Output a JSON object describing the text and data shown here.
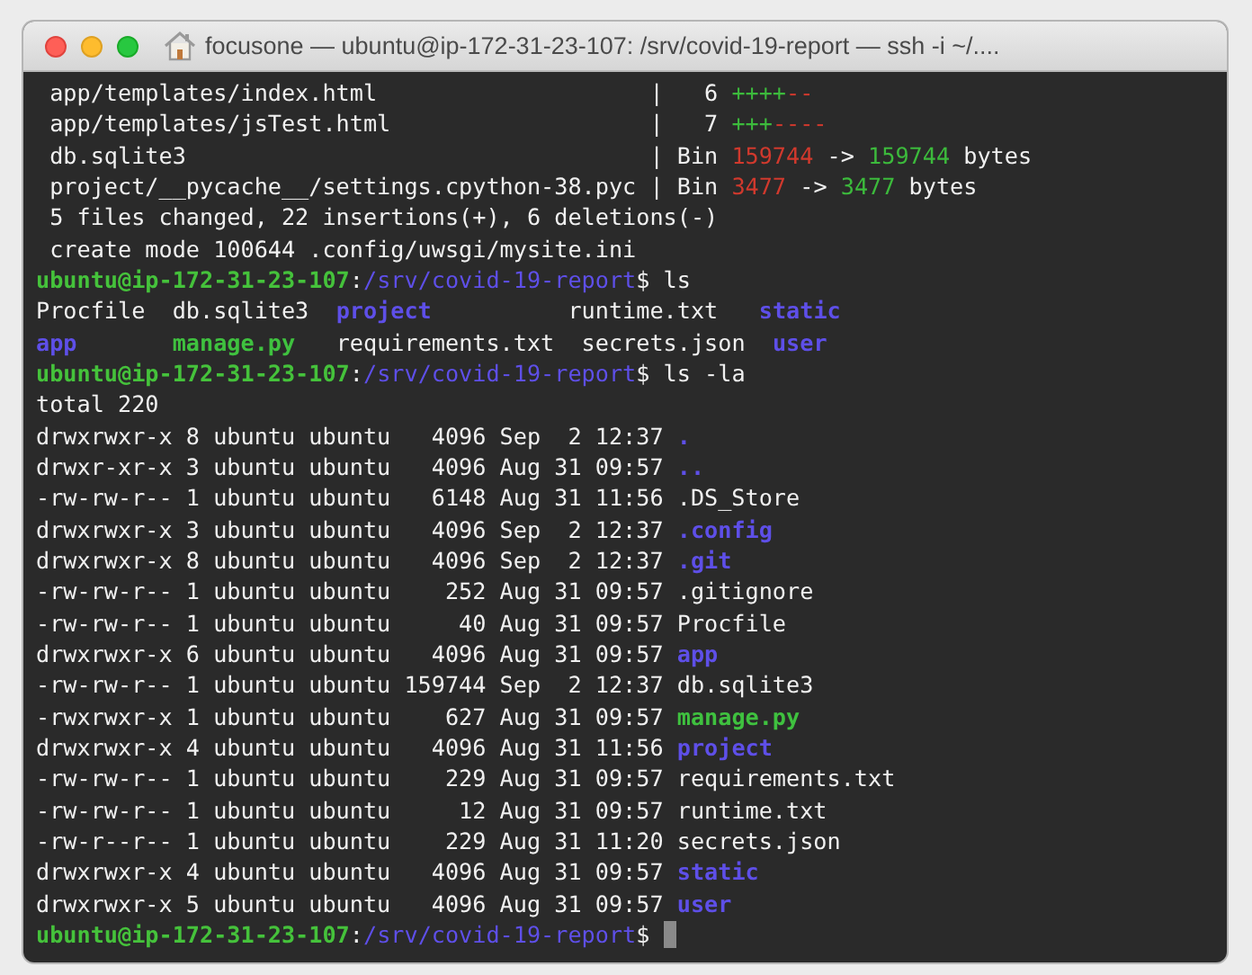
{
  "window": {
    "title": "focusone — ubuntu@ip-172-31-23-107: /srv/covid-19-report — ssh -i ~/...."
  },
  "terminal": {
    "cursor": true,
    "lines": [
      [
        {
          "kind": "plain",
          "text": " app/templates/index.html                    |   6 "
        },
        {
          "kind": "added",
          "text": "++++"
        },
        {
          "kind": "removed",
          "text": "--"
        }
      ],
      [
        {
          "kind": "plain",
          "text": " app/templates/jsTest.html                   |   7 "
        },
        {
          "kind": "added",
          "text": "+++"
        },
        {
          "kind": "removed",
          "text": "----"
        }
      ],
      [
        {
          "kind": "plain",
          "text": " db.sqlite3                                  | Bin "
        },
        {
          "kind": "removed",
          "text": "159744"
        },
        {
          "kind": "plain",
          "text": " -> "
        },
        {
          "kind": "added",
          "text": "159744"
        },
        {
          "kind": "plain",
          "text": " bytes"
        }
      ],
      [
        {
          "kind": "plain",
          "text": " project/__pycache__/settings.cpython-38.pyc | Bin "
        },
        {
          "kind": "removed",
          "text": "3477"
        },
        {
          "kind": "plain",
          "text": " -> "
        },
        {
          "kind": "added",
          "text": "3477"
        },
        {
          "kind": "plain",
          "text": " bytes"
        }
      ],
      [
        {
          "kind": "plain",
          "text": " 5 files changed, 22 insertions(+), 6 deletions(-)"
        }
      ],
      [
        {
          "kind": "plain",
          "text": " create mode 100644 .config/uwsgi/mysite.ini"
        }
      ],
      [
        {
          "kind": "user",
          "text": "ubuntu@ip-172-31-23-107"
        },
        {
          "kind": "plain",
          "text": ":"
        },
        {
          "kind": "path",
          "text": "/srv/covid-19-report"
        },
        {
          "kind": "plain",
          "text": "$ ls"
        }
      ],
      [
        {
          "kind": "plain",
          "text": "Procfile  db.sqlite3  "
        },
        {
          "kind": "dir",
          "text": "project"
        },
        {
          "kind": "plain",
          "text": "          runtime.txt   "
        },
        {
          "kind": "dir",
          "text": "static"
        }
      ],
      [
        {
          "kind": "dir",
          "text": "app"
        },
        {
          "kind": "exec",
          "text": "       manage.py"
        },
        {
          "kind": "plain",
          "text": "   requirements.txt  secrets.json  "
        },
        {
          "kind": "dir",
          "text": "user"
        }
      ],
      [
        {
          "kind": "user",
          "text": "ubuntu@ip-172-31-23-107"
        },
        {
          "kind": "plain",
          "text": ":"
        },
        {
          "kind": "path",
          "text": "/srv/covid-19-report"
        },
        {
          "kind": "plain",
          "text": "$ ls -la"
        }
      ],
      [
        {
          "kind": "plain",
          "text": "total 220"
        }
      ],
      [
        {
          "kind": "plain",
          "text": "drwxrwxr-x 8 ubuntu ubuntu   4096 Sep  2 12:37 "
        },
        {
          "kind": "dir",
          "text": "."
        }
      ],
      [
        {
          "kind": "plain",
          "text": "drwxr-xr-x 3 ubuntu ubuntu   4096 Aug 31 09:57 "
        },
        {
          "kind": "dir",
          "text": ".."
        }
      ],
      [
        {
          "kind": "plain",
          "text": "-rw-rw-r-- 1 ubuntu ubuntu   6148 Aug 31 11:56 .DS_Store"
        }
      ],
      [
        {
          "kind": "plain",
          "text": "drwxrwxr-x 3 ubuntu ubuntu   4096 Sep  2 12:37 "
        },
        {
          "kind": "dir",
          "text": ".config"
        }
      ],
      [
        {
          "kind": "plain",
          "text": "drwxrwxr-x 8 ubuntu ubuntu   4096 Sep  2 12:37 "
        },
        {
          "kind": "dir",
          "text": ".git"
        }
      ],
      [
        {
          "kind": "plain",
          "text": "-rw-rw-r-- 1 ubuntu ubuntu    252 Aug 31 09:57 .gitignore"
        }
      ],
      [
        {
          "kind": "plain",
          "text": "-rw-rw-r-- 1 ubuntu ubuntu     40 Aug 31 09:57 Procfile"
        }
      ],
      [
        {
          "kind": "plain",
          "text": "drwxrwxr-x 6 ubuntu ubuntu   4096 Aug 31 09:57 "
        },
        {
          "kind": "dir",
          "text": "app"
        }
      ],
      [
        {
          "kind": "plain",
          "text": "-rw-rw-r-- 1 ubuntu ubuntu 159744 Sep  2 12:37 db.sqlite3"
        }
      ],
      [
        {
          "kind": "plain",
          "text": "-rwxrwxr-x 1 ubuntu ubuntu    627 Aug 31 09:57 "
        },
        {
          "kind": "exec",
          "text": "manage.py"
        }
      ],
      [
        {
          "kind": "plain",
          "text": "drwxrwxr-x 4 ubuntu ubuntu   4096 Aug 31 11:56 "
        },
        {
          "kind": "dir",
          "text": "project"
        }
      ],
      [
        {
          "kind": "plain",
          "text": "-rw-rw-r-- 1 ubuntu ubuntu    229 Aug 31 09:57 requirements.txt"
        }
      ],
      [
        {
          "kind": "plain",
          "text": "-rw-rw-r-- 1 ubuntu ubuntu     12 Aug 31 09:57 runtime.txt"
        }
      ],
      [
        {
          "kind": "plain",
          "text": "-rw-r--r-- 1 ubuntu ubuntu    229 Aug 31 11:20 secrets.json"
        }
      ],
      [
        {
          "kind": "plain",
          "text": "drwxrwxr-x 4 ubuntu ubuntu   4096 Aug 31 09:57 "
        },
        {
          "kind": "dir",
          "text": "static"
        }
      ],
      [
        {
          "kind": "plain",
          "text": "drwxrwxr-x 5 ubuntu ubuntu   4096 Aug 31 09:57 "
        },
        {
          "kind": "dir",
          "text": "user"
        }
      ],
      [
        {
          "kind": "user",
          "text": "ubuntu@ip-172-31-23-107"
        },
        {
          "kind": "plain",
          "text": ":"
        },
        {
          "kind": "path",
          "text": "/srv/covid-19-report"
        },
        {
          "kind": "plain",
          "text": "$ "
        }
      ]
    ]
  }
}
